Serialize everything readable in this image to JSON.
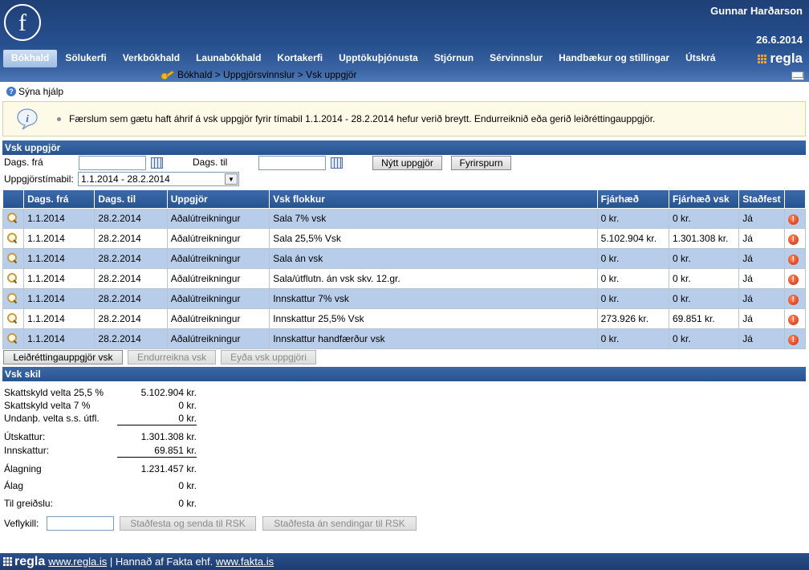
{
  "header": {
    "user_name": "Gunnar Harðarson",
    "date": "26.6.2014",
    "brand": "regla",
    "nav": [
      {
        "label": "Bókhald",
        "active": true
      },
      {
        "label": "Sölukerfi"
      },
      {
        "label": "Verkbókhald"
      },
      {
        "label": "Launabókhald"
      },
      {
        "label": "Kortakerfi"
      },
      {
        "label": "Upptökuþjónusta"
      },
      {
        "label": "Stjórnun"
      },
      {
        "label": "Sérvinnslur"
      },
      {
        "label": "Handbækur og stillingar"
      },
      {
        "label": "Útskrá"
      }
    ],
    "breadcrumb": "Bókhald > Uppgjörsvinnslur > Vsk uppgjör"
  },
  "help_label": "Sýna hjálp",
  "info_message": "Færslum sem gætu haft áhrif á vsk uppgjör fyrir tímabil 1.1.2014 - 28.2.2014 hefur verið breytt. Endurreiknið eða gerið leiðréttingauppgjör.",
  "vsk_uppgjor": {
    "title": "Vsk uppgjör",
    "dags_fra_label": "Dags. frá",
    "dags_fra_value": "",
    "dags_til_label": "Dags. til",
    "dags_til_value": "",
    "new_button": "Nýtt uppgjör",
    "query_button": "Fyrirspurn",
    "period_label": "Uppgjörstímabil:",
    "period_value": "1.1.2014 - 28.2.2014",
    "columns": [
      "Dags. frá",
      "Dags. til",
      "Uppgjör",
      "Vsk flokkur",
      "Fjárhæð",
      "Fjárhæð vsk",
      "Staðfest"
    ],
    "rows": [
      {
        "from": "1.1.2014",
        "to": "28.2.2014",
        "type": "Aðalútreikningur",
        "category": "Sala 7% vsk",
        "amount": "0 kr.",
        "vat": "0 kr.",
        "confirmed": "Já"
      },
      {
        "from": "1.1.2014",
        "to": "28.2.2014",
        "type": "Aðalútreikningur",
        "category": "Sala 25,5% Vsk",
        "amount": "5.102.904 kr.",
        "vat": "1.301.308 kr.",
        "confirmed": "Já"
      },
      {
        "from": "1.1.2014",
        "to": "28.2.2014",
        "type": "Aðalútreikningur",
        "category": "Sala án vsk",
        "amount": "0 kr.",
        "vat": "0 kr.",
        "confirmed": "Já"
      },
      {
        "from": "1.1.2014",
        "to": "28.2.2014",
        "type": "Aðalútreikningur",
        "category": "Sala/útflutn. án vsk skv. 12.gr.",
        "amount": "0 kr.",
        "vat": "0 kr.",
        "confirmed": "Já"
      },
      {
        "from": "1.1.2014",
        "to": "28.2.2014",
        "type": "Aðalútreikningur",
        "category": "Innskattur 7% vsk",
        "amount": "0 kr.",
        "vat": "0 kr.",
        "confirmed": "Já"
      },
      {
        "from": "1.1.2014",
        "to": "28.2.2014",
        "type": "Aðalútreikningur",
        "category": "Innskattur 25,5% Vsk",
        "amount": "273.926 kr.",
        "vat": "69.851 kr.",
        "confirmed": "Já"
      },
      {
        "from": "1.1.2014",
        "to": "28.2.2014",
        "type": "Aðalútreikningur",
        "category": "Innskattur handfærður vsk",
        "amount": "0 kr.",
        "vat": "0 kr.",
        "confirmed": "Já"
      }
    ],
    "correction_button": "Leiðréttingauppgjör vsk",
    "recalc_button": "Endurreikna vsk",
    "delete_button": "Eyða vsk uppgjöri"
  },
  "vsk_skil": {
    "title": "Vsk skil",
    "lines": [
      {
        "label": "Skattskyld velta 25,5 %",
        "value": "5.102.904 kr."
      },
      {
        "label": "Skattskyld velta 7 %",
        "value": "0 kr."
      },
      {
        "label": "Undanþ. velta s.s. útfl.",
        "value": "0 kr."
      },
      {
        "label": "Útskattur:",
        "value": "1.301.308 kr."
      },
      {
        "label": "Innskattur:",
        "value": "69.851 kr."
      },
      {
        "label": "Álagning",
        "value": "1.231.457 kr."
      },
      {
        "label": "Álag",
        "value": "0 kr."
      },
      {
        "label": "Til greiðslu:",
        "value": "0 kr."
      }
    ],
    "key_label": "Veflykill:",
    "key_value": "",
    "confirm_send_button": "Staðfesta og senda til RSK",
    "confirm_nosend_button": "Staðfesta án sendingar til RSK"
  },
  "footer": {
    "brand": "regla",
    "link1": "www.regla.is",
    "separator": " | Hannað af Fakta ehf. ",
    "link2": "www.fakta.is"
  }
}
